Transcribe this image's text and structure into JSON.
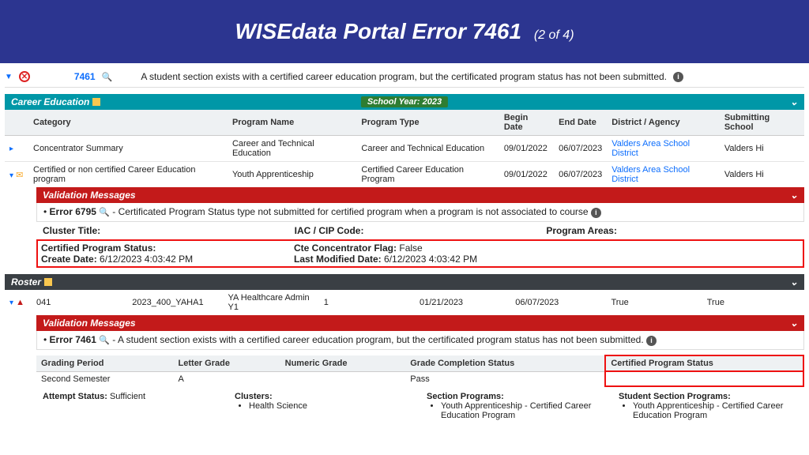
{
  "banner": {
    "title": "WISEdata Portal Error 7461",
    "sub": "(2 of 4)"
  },
  "topError": {
    "code": "7461",
    "desc": "A student section exists with a certified career education program, but the certificated program status has not been submitted."
  },
  "careerEd": {
    "title": "Career Education",
    "yearBadge": "School Year: 2023",
    "cols": {
      "c1": "Category",
      "c2": "Program Name",
      "c3": "Program Type",
      "c4": "Begin Date",
      "c5": "End Date",
      "c6": "District / Agency",
      "c7": "Submitting School"
    },
    "rows": [
      {
        "cat": "Concentrator Summary",
        "prog": "Career and Technical Education",
        "type": "Career and Technical Education",
        "begin": "09/01/2022",
        "end": "06/07/2023",
        "dist": "Valders Area School District",
        "school": "Valders Hi"
      },
      {
        "cat": "Certified or non certified Career Education program",
        "prog": "Youth Apprenticeship",
        "type": "Certified Career Education Program",
        "begin": "09/01/2022",
        "end": "06/07/2023",
        "dist": "Valders Area School District",
        "school": "Valders Hi"
      }
    ],
    "validation": {
      "hdr": "Validation Messages",
      "line": "Error 6795",
      "lineTail": " - Certificated Program Status type not submitted for certified program when a program is not associated to course"
    },
    "details": {
      "clusterLbl": "Cluster Title:",
      "iacLbl": "IAC / CIP Code:",
      "areasLbl": "Program Areas:",
      "certStatusLbl": "Certified Program Status:",
      "createLbl": "Create Date:",
      "createVal": "6/12/2023 4:03:42 PM",
      "cteLbl": "Cte Concentrator Flag:",
      "cteVal": "False",
      "modLbl": "Last Modified Date:",
      "modVal": "6/12/2023 4:03:42 PM"
    }
  },
  "roster": {
    "title": "Roster",
    "row": {
      "a": "041",
      "b": "2023_400_YAHA1",
      "c": "YA Healthcare Admin Y1",
      "d": "1",
      "e": "01/21/2023",
      "f": "06/07/2023",
      "g": "True",
      "h": "True"
    },
    "validation": {
      "hdr": "Validation Messages",
      "line": "Error 7461",
      "lineTail": " - A student section exists with a certified career education program, but the certificated program status has not been submitted."
    },
    "grades": {
      "h1": "Grading Period",
      "h2": "Letter Grade",
      "h3": "Numeric Grade",
      "h4": "Grade Completion Status",
      "h5": "Certified Program Status",
      "v1": "Second Semester",
      "v2": "A",
      "v3": "",
      "v4": "Pass",
      "v5": ""
    },
    "progs": {
      "attemptLbl": "Attempt Status:",
      "attemptVal": "Sufficient",
      "clustersLbl": "Clusters:",
      "clustersVal": "Health Science",
      "sectLbl": "Section Programs:",
      "sectVal": "Youth Apprenticeship - Certified Career Education Program",
      "studLbl": "Student Section Programs:",
      "studVal": "Youth Apprenticeship - Certified Career Education Program"
    }
  }
}
